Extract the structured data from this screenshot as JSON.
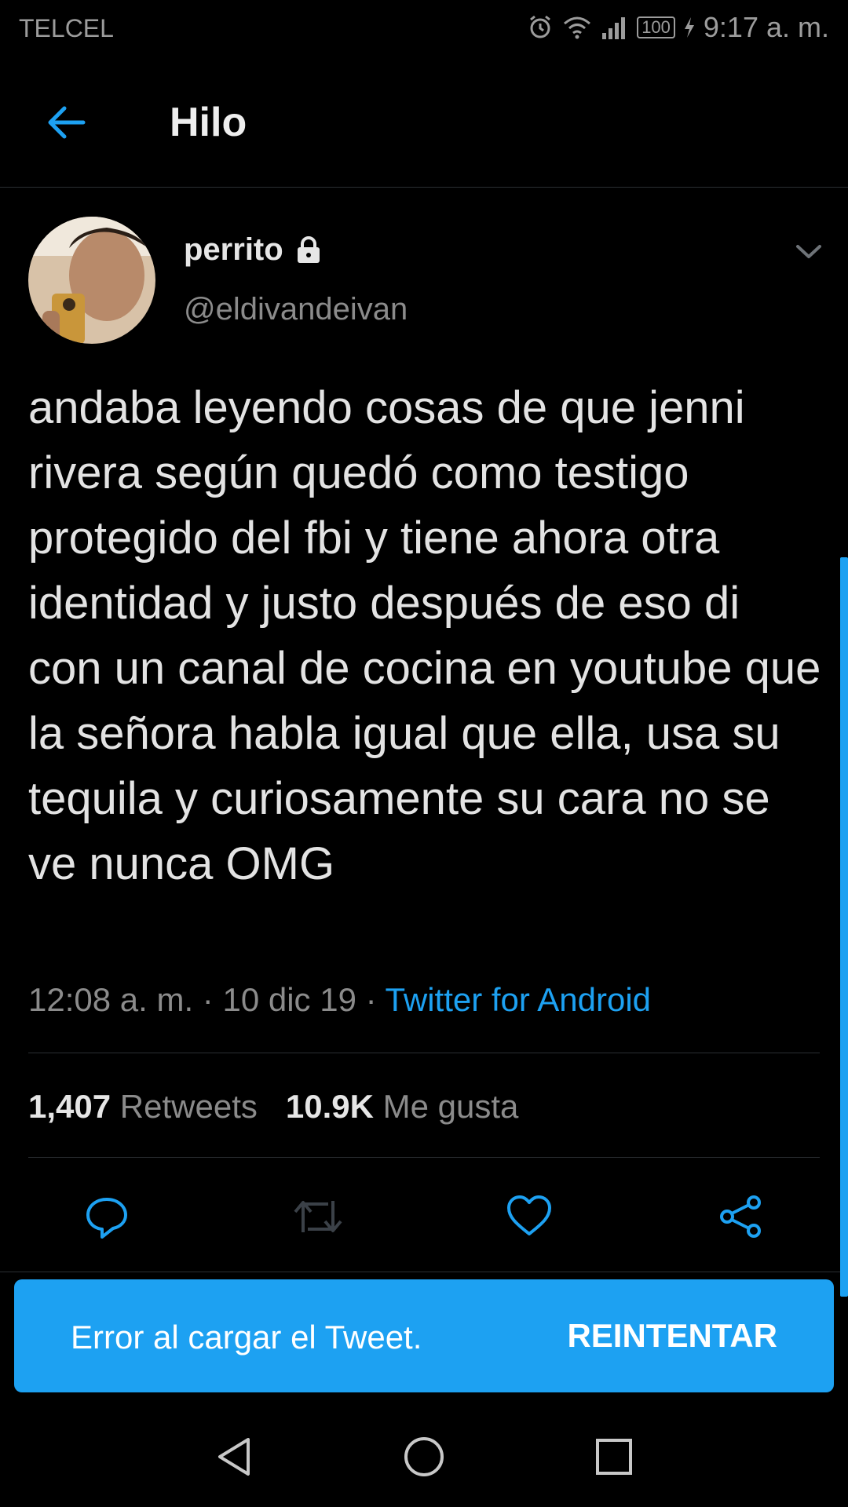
{
  "status_bar": {
    "carrier": "TELCEL",
    "battery": "100",
    "time": "9:17 a. m.",
    "icons": [
      "alarm-icon",
      "wifi-icon",
      "signal-icon",
      "battery-icon",
      "charging-icon"
    ]
  },
  "header": {
    "title": "Hilo",
    "back_icon": "arrow-left-icon"
  },
  "tweet": {
    "author_name": "perrito",
    "author_handle": "@eldivandeivan",
    "protected_icon": "lock-icon",
    "text": "andaba leyendo cosas de que jenni rivera según quedó como testigo protegido del fbi y tiene ahora otra identidad y justo después de eso di con un canal de cocina en youtube que la señora habla igual que ella, usa su tequila y curiosamente su cara no se ve nunca OMG",
    "time": "12:08 a. m.",
    "date": "10 dic 19",
    "separator": "·",
    "source": "Twitter for Android",
    "retweets_count": "1,407",
    "retweets_label": "Retweets",
    "likes_count": "10.9K",
    "likes_label": "Me gusta"
  },
  "actions": [
    "reply-icon",
    "retweet-icon",
    "like-icon",
    "share-icon"
  ],
  "error_bar": {
    "message": "Error al cargar el Tweet.",
    "retry_label": "REINTENTAR"
  },
  "colors": {
    "accent": "#1da1f2",
    "background": "#000000",
    "divider": "#2b2f33",
    "muted": "#8b8b8b"
  }
}
